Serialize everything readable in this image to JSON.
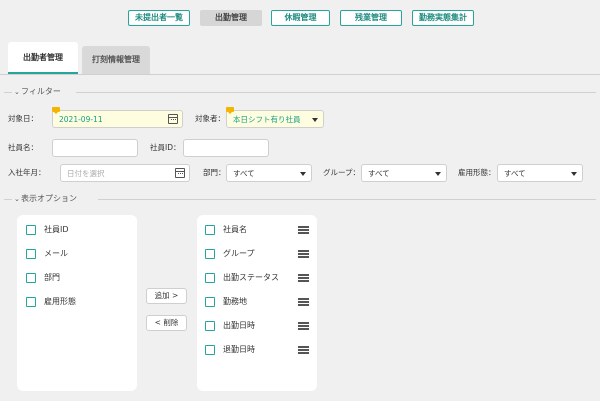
{
  "topnav": [
    {
      "label": "未提出者一覧",
      "active": false
    },
    {
      "label": "出勤管理",
      "active": true
    },
    {
      "label": "休暇管理",
      "active": false
    },
    {
      "label": "残業管理",
      "active": false
    },
    {
      "label": "勤務実態集計",
      "active": false
    }
  ],
  "tabs": [
    {
      "label": "出勤者管理",
      "active": true
    },
    {
      "label": "打刻情報管理",
      "active": false
    }
  ],
  "filter": {
    "section_label": "フィルター",
    "date_label": "対象日：",
    "date_value": "2021-09-11",
    "target_label": "対象者：",
    "target_value": "本日シフト有り社員",
    "name_label": "社員名：",
    "name_value": "",
    "id_label": "社員ID：",
    "id_value": "",
    "join_label": "入社年月：",
    "join_placeholder": "日付を選択",
    "dept_label": "部門：",
    "dept_value": "すべて",
    "group_label": "グループ：",
    "group_value": "すべて",
    "emp_label": "雇用形態：",
    "emp_value": "すべて"
  },
  "display": {
    "section_label": "表示オプション",
    "available": [
      "社員ID",
      "メール",
      "部門",
      "雇用形態"
    ],
    "selected": [
      "社員名",
      "グループ",
      "出勤ステータス",
      "勤務地",
      "出勤日時",
      "退勤日時"
    ],
    "add_label": "追加",
    "remove_label": "削除"
  },
  "colors": {
    "accent": "#26a69a",
    "highlight_bg": "#fffde0",
    "flag": "#f5b400"
  },
  "icons": {
    "calendar": "calendar-icon",
    "dropdown": "caret-down-icon",
    "drag": "drag-handle-icon"
  }
}
